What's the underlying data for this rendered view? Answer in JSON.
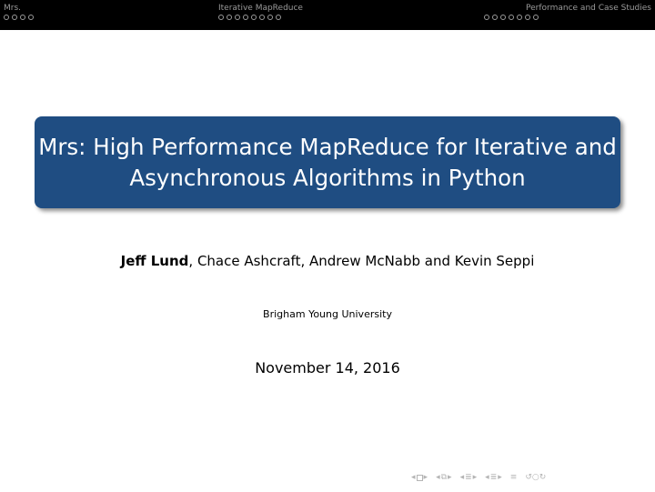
{
  "nav": {
    "sections": [
      {
        "label": "Mrs.",
        "dots": 4
      },
      {
        "label": "Iterative MapReduce",
        "dots": 8
      },
      {
        "label": "Performance and Case Studies",
        "dots": 7
      }
    ]
  },
  "title": {
    "line1": "Mrs: High Performance MapReduce for Iterative and",
    "line2": "Asynchronous Algorithms in Python"
  },
  "authors": {
    "presenter": "Jeff Lund",
    "others": ", Chace Ashcraft, Andrew McNabb and Kevin Seppi"
  },
  "institute": "Brigham Young University",
  "date": "November 14, 2016",
  "colors": {
    "header_bg": "#000000",
    "title_bg": "#1f4d82",
    "title_fg": "#ffffff"
  },
  "navigation_symbols": [
    "prev-frame-icon",
    "next-frame-icon",
    "prev-slide-icon",
    "next-slide-icon",
    "prev-section-icon",
    "next-section-icon",
    "prev-subsection-icon",
    "next-subsection-icon",
    "align-icon",
    "search-icon"
  ]
}
